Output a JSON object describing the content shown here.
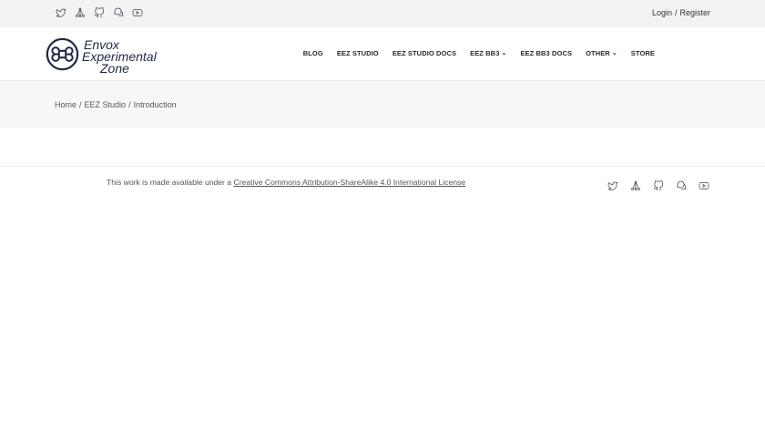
{
  "topbar": {
    "social_icons": [
      "twitter-icon",
      "network-icon",
      "github-icon",
      "forum-icon",
      "youtube-icon"
    ],
    "login_label": "Login",
    "separator": "/",
    "register_label": "Register"
  },
  "header": {
    "logo_lines": [
      "Envox",
      "Experimental",
      "Zone"
    ],
    "nav": [
      {
        "label": "BLOG"
      },
      {
        "label": "EEZ STUDIO"
      },
      {
        "label": "EEZ STUDIO DOCS"
      },
      {
        "label": "EEZ BB3"
      },
      {
        "label": "EEZ BB3 DOCS"
      },
      {
        "label": "OTHER"
      },
      {
        "label": "STORE"
      }
    ]
  },
  "breadcrumb": {
    "items": [
      "Home",
      "EEZ Studio",
      "Introduction"
    ],
    "separator": "/"
  },
  "footer": {
    "license_prefix": "This work is made available under a",
    "license_link": "Creative Commons Attribution-ShareAlike 4.0 International License",
    "social_icons": [
      "twitter-icon",
      "network-icon",
      "github-icon",
      "forum-icon",
      "youtube-icon"
    ]
  },
  "colors": {
    "topbar_bg": "#f3f3f3",
    "crumbbar_bg": "#f7f7f7",
    "logo": "#1f2a44",
    "text": "#333333"
  }
}
